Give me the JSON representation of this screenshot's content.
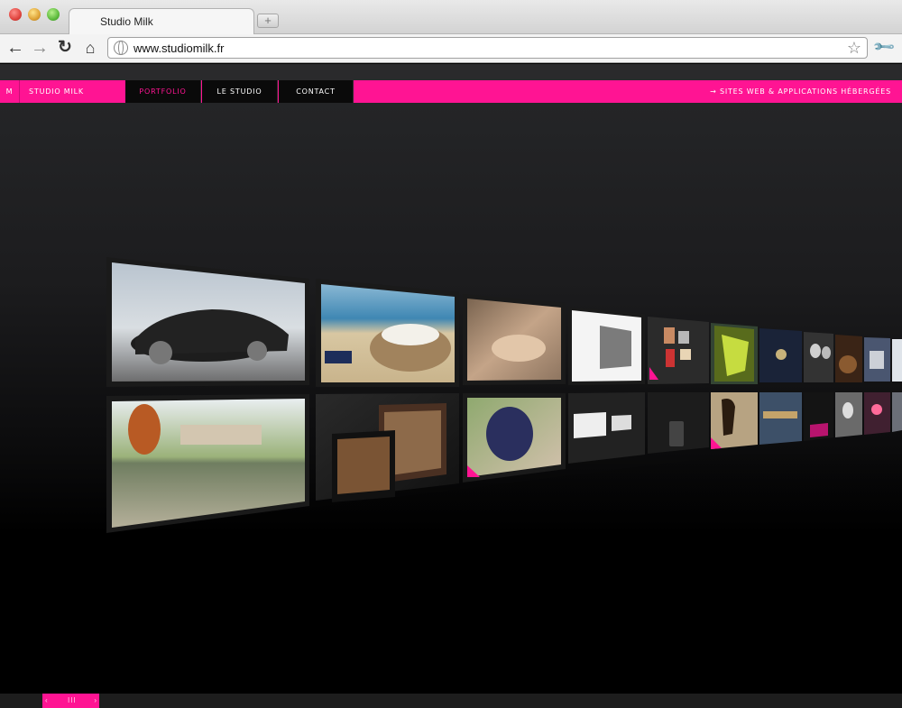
{
  "browser": {
    "tab_title": "Studio Milk",
    "new_tab_label": "+",
    "url": "www.studiomilk.fr",
    "icons": {
      "back": "back-arrow-icon",
      "forward": "forward-arrow-icon",
      "reload": "reload-icon",
      "home": "home-icon",
      "bookmark": "star-icon",
      "menu": "wrench-icon"
    }
  },
  "site": {
    "logo": "M",
    "brand": "STUDIO MILK",
    "menu": [
      {
        "label": "PORTFOLIO",
        "active": true
      },
      {
        "label": "LE STUDIO",
        "active": false
      },
      {
        "label": "CONTACT",
        "active": false
      }
    ],
    "hosted_link": "→ SITES WEB & APPLICATIONS HÉBERGÉES",
    "accent_color": "#ff1493"
  },
  "portfolio": {
    "top_row": [
      "sports-car-photo",
      "wicker-beach-chair-photo",
      "classical-painting",
      "house-graphic-site",
      "collage-site",
      "vine-leaf-photo",
      "dark-label-site",
      "vintage-portrait-photo",
      "barrels-photo",
      "building-photo",
      "partial-thumb"
    ],
    "bottom_row": [
      "lake-chateau-photo",
      "tablet-phone-site",
      "grapes-hand-photo",
      "brochure-site",
      "phone-dark-site",
      "horse-statue-photo",
      "lake-reflection-photo",
      "dark-site",
      "bw-couple-photo",
      "concert-photo",
      "partial-thumb"
    ]
  },
  "scrollbar": {
    "left_arrow": "‹",
    "grip": "III",
    "right_arrow": "›"
  }
}
